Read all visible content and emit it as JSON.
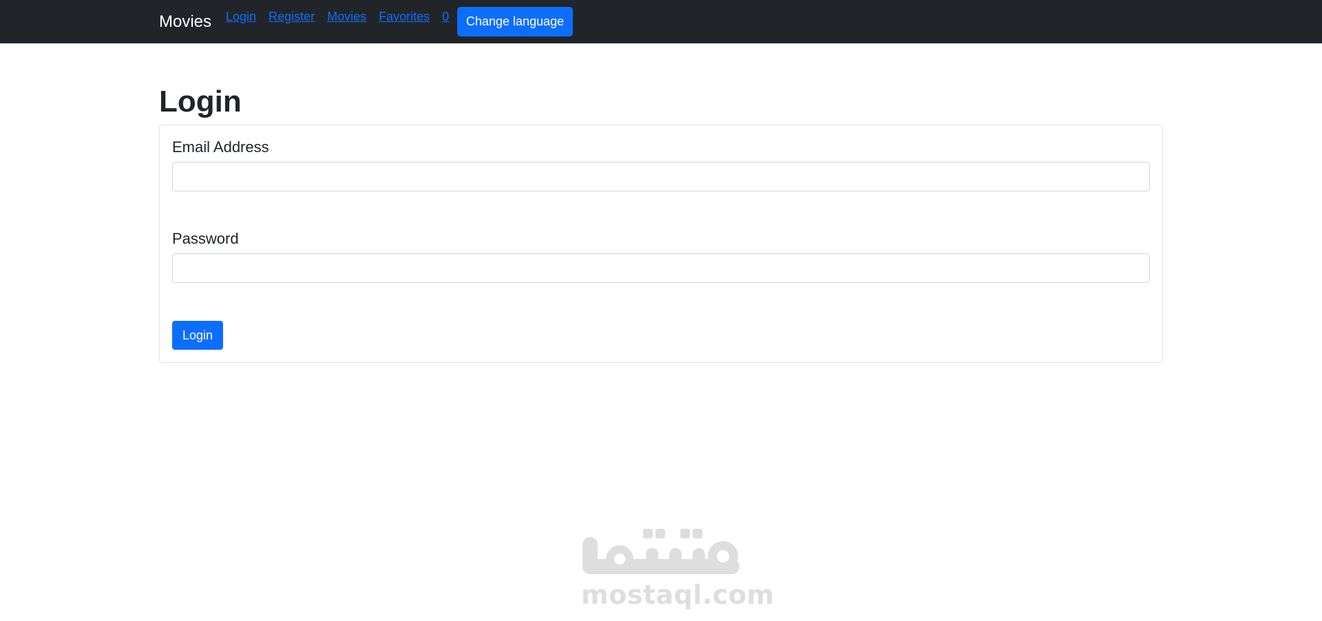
{
  "navbar": {
    "brand": "Movies",
    "links": [
      {
        "label": "Login"
      },
      {
        "label": "Register"
      },
      {
        "label": "Movies"
      },
      {
        "label": "Favorites"
      },
      {
        "label": "0"
      }
    ],
    "change_language_label": "Change language"
  },
  "main": {
    "title": "Login",
    "form": {
      "email_label": "Email Address",
      "email_value": "",
      "password_label": "Password",
      "password_value": "",
      "submit_label": "Login"
    }
  },
  "watermark": {
    "text": "mostaql.com"
  },
  "colors": {
    "navbar_bg": "#212529",
    "primary": "#0d6efd",
    "text": "#212529",
    "watermark": "#dedede"
  },
  "icons": {
    "watermark_logo": "mostaql-logo"
  }
}
